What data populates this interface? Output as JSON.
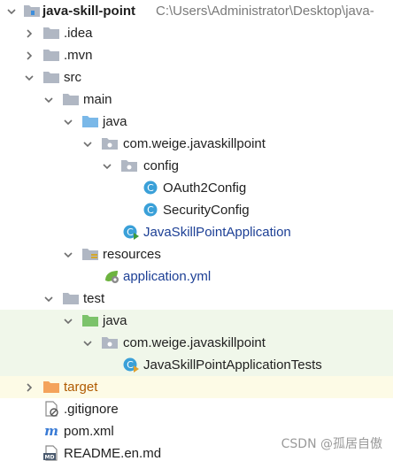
{
  "project": {
    "name": "java-skill-point",
    "path": "C:\\Users\\Administrator\\Desktop\\java-"
  },
  "tree": {
    "idea": ".idea",
    "mvn": ".mvn",
    "src": "src",
    "main": "main",
    "main_java": "java",
    "main_pkg": "com.weige.javaskillpoint",
    "config": "config",
    "oauth": "OAuth2Config",
    "security": "SecurityConfig",
    "app": "JavaSkillPointApplication",
    "resources": "resources",
    "yml": "application.yml",
    "test": "test",
    "test_java": "java",
    "test_pkg": "com.weige.javaskillpoint",
    "tests": "JavaSkillPointApplicationTests",
    "target": "target",
    "gitignore": ".gitignore",
    "pom": "pom.xml",
    "readme": "README.en.md"
  },
  "watermark": "CSDN @孤居自傲",
  "colors": {
    "folder": "#b0b7c3",
    "source_folder": "#7ab8e8",
    "test_folder": "#7cc36b",
    "target_folder": "#f4a35c",
    "class_icon": "#3aa0d8",
    "test_row_bg": "#f0f7ea",
    "target_row_bg": "#fdfbe6"
  }
}
